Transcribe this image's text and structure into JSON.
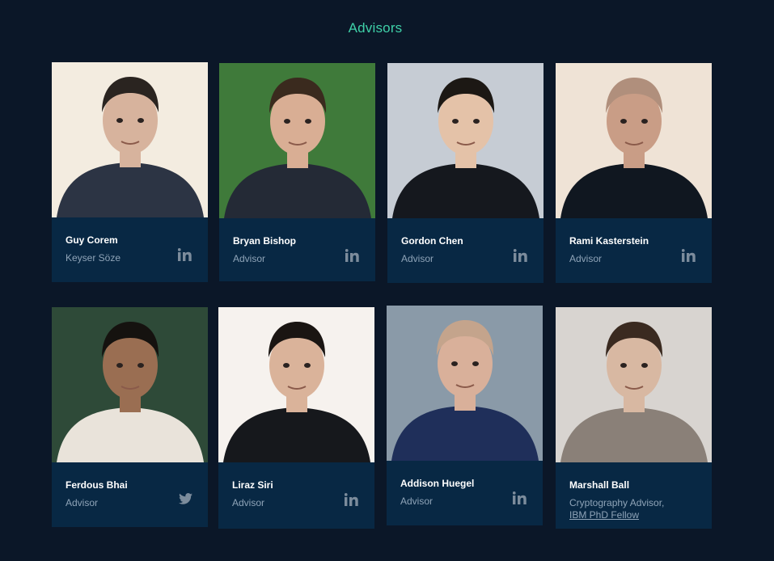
{
  "section": {
    "title": "Advisors"
  },
  "advisors": [
    {
      "name": "Guy Corem",
      "role": "Keyser Söze",
      "social": "linkedin-icon",
      "photo": {
        "bg": "#f3ece0",
        "shirt": "#2c3444",
        "hair": "#2a2420",
        "skin": "#d7b39d"
      }
    },
    {
      "name": "Bryan Bishop",
      "role": "Advisor",
      "social": "linkedin-icon",
      "photo": {
        "bg": "#3f7a3a",
        "shirt": "#242a36",
        "hair": "#3a2a1e",
        "skin": "#d9ae94"
      }
    },
    {
      "name": "Gordon Chen",
      "role": "Advisor",
      "social": "linkedin-icon",
      "photo": {
        "bg": "#c6ccd4",
        "shirt": "#15181e",
        "hair": "#1c1814",
        "skin": "#e4c2a8"
      }
    },
    {
      "name": "Rami Kasterstein",
      "role": "Advisor",
      "social": "linkedin-icon",
      "photo": {
        "bg": "#efe3d6",
        "shirt": "#101720",
        "hair": "#b08f7c",
        "skin": "#c99d86"
      }
    },
    {
      "name": "Ferdous Bhai",
      "role": "Advisor",
      "social": "twitter-icon",
      "photo": {
        "bg": "#2e4a38",
        "shirt": "#e9e3da",
        "hair": "#15120f",
        "skin": "#9a6e52"
      }
    },
    {
      "name": "Liraz Siri",
      "role": "Advisor",
      "social": "linkedin-icon",
      "photo": {
        "bg": "#f6f2ee",
        "shirt": "#16181c",
        "hair": "#1a1512",
        "skin": "#dab39a"
      }
    },
    {
      "name": "Addison Huegel",
      "role": "Advisor",
      "social": "linkedin-icon",
      "photo": {
        "bg": "#8a9aa8",
        "shirt": "#1f2f5a",
        "hair": "#c4a48c",
        "skin": "#d9b09a"
      }
    },
    {
      "name": "Marshall Ball",
      "role": "Cryptography Advisor,",
      "role_link": "IBM PhD Fellow",
      "social": "",
      "photo": {
        "bg": "#d8d4d0",
        "shirt": "#8a8078",
        "hair": "#3a2a20",
        "skin": "#d8b8a2"
      }
    }
  ]
}
